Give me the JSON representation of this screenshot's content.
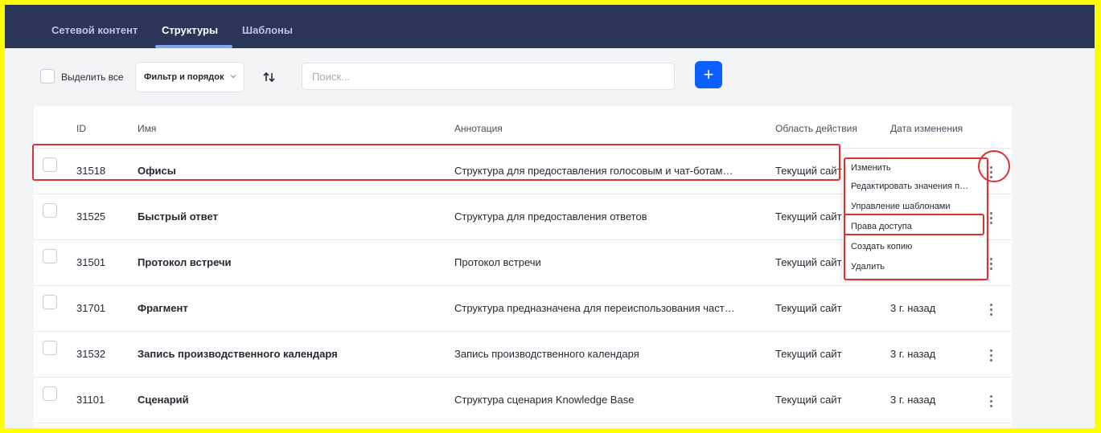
{
  "nav": {
    "tabs": [
      {
        "label": "Сетевой контент"
      },
      {
        "label": "Структуры",
        "active": true
      },
      {
        "label": "Шаблоны"
      }
    ]
  },
  "toolbar": {
    "select_all_label": "Выделить все",
    "filter_label": "Фильтр и порядок",
    "search_placeholder": "Поиск...",
    "add_label": "+"
  },
  "table": {
    "headers": {
      "id": "ID",
      "name": "Имя",
      "annotation": "Аннотация",
      "scope": "Область действия",
      "modified": "Дата изменения"
    },
    "rows": [
      {
        "id": "31518",
        "name": "Офисы",
        "annotation": "Структура для предоставления голосовым и чат-ботам…",
        "scope": "Текущий сайт",
        "modified": ""
      },
      {
        "id": "31525",
        "name": "Быстрый ответ",
        "annotation": "Структура для предоставления ответов",
        "scope": "Текущий сайт",
        "modified": ""
      },
      {
        "id": "31501",
        "name": "Протокол встречи",
        "annotation": "Протокол встречи",
        "scope": "Текущий сайт",
        "modified": ""
      },
      {
        "id": "31701",
        "name": "Фрагмент",
        "annotation": "Структура предназначена для переиспользования част…",
        "scope": "Текущий сайт",
        "modified": "3 г. назад"
      },
      {
        "id": "31532",
        "name": "Запись производственного календаря",
        "annotation": "Запись производственного календаря",
        "scope": "Текущий сайт",
        "modified": "3 г. назад"
      },
      {
        "id": "31101",
        "name": "Сценарий",
        "annotation": "Структура сценария Knowledge Base",
        "scope": "Текущий сайт",
        "modified": "3 г. назад"
      }
    ]
  },
  "menu": {
    "items": [
      {
        "label": "Изменить"
      },
      {
        "label": "Редактировать значения п…"
      },
      {
        "label": "Управление шаблонами"
      },
      {
        "label": "Права доступа"
      },
      {
        "label": "Создать копию"
      },
      {
        "label": "Удалить"
      }
    ]
  },
  "colors": {
    "nav_bg": "#2a3557",
    "accent": "#0b5fff",
    "highlight": "#e03131",
    "frame": "#ffff00"
  }
}
